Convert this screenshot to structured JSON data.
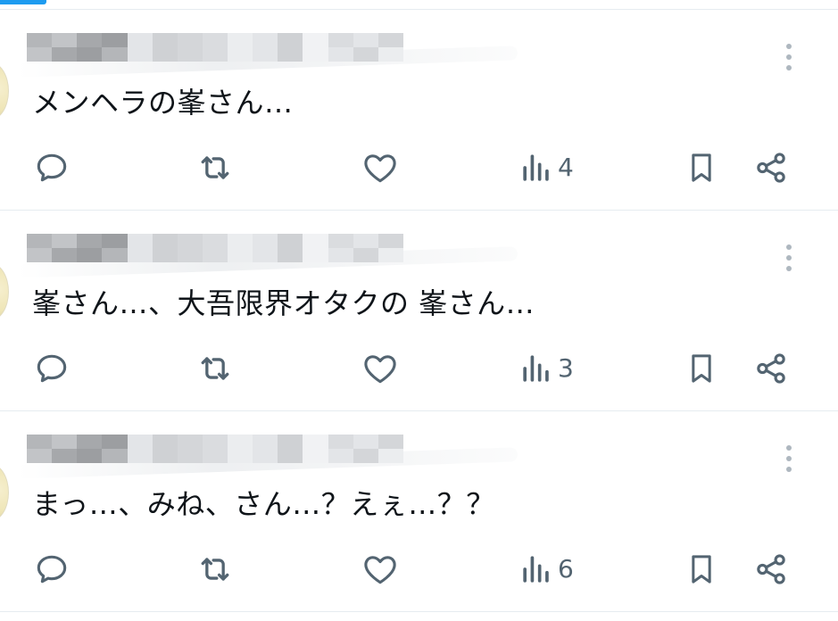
{
  "colors": {
    "accent": "#1d9bf0",
    "action_icon": "#536471",
    "text": "#0f1419",
    "divider": "#e6ecf0"
  },
  "tweets": [
    {
      "text": "メンヘラの峯さん…",
      "views": "4"
    },
    {
      "text": "峯さん…、大吾限界オタクの 峯さん…",
      "views": "3"
    },
    {
      "text": "まっ…、みね、さん…？えぇ…？？",
      "views": "6"
    }
  ],
  "icons": {
    "more": "more-vertical-icon",
    "reply": "reply-icon",
    "retweet": "retweet-icon",
    "like": "heart-icon",
    "views": "bar-chart-icon",
    "bookmark": "bookmark-icon",
    "share": "share-icon"
  }
}
